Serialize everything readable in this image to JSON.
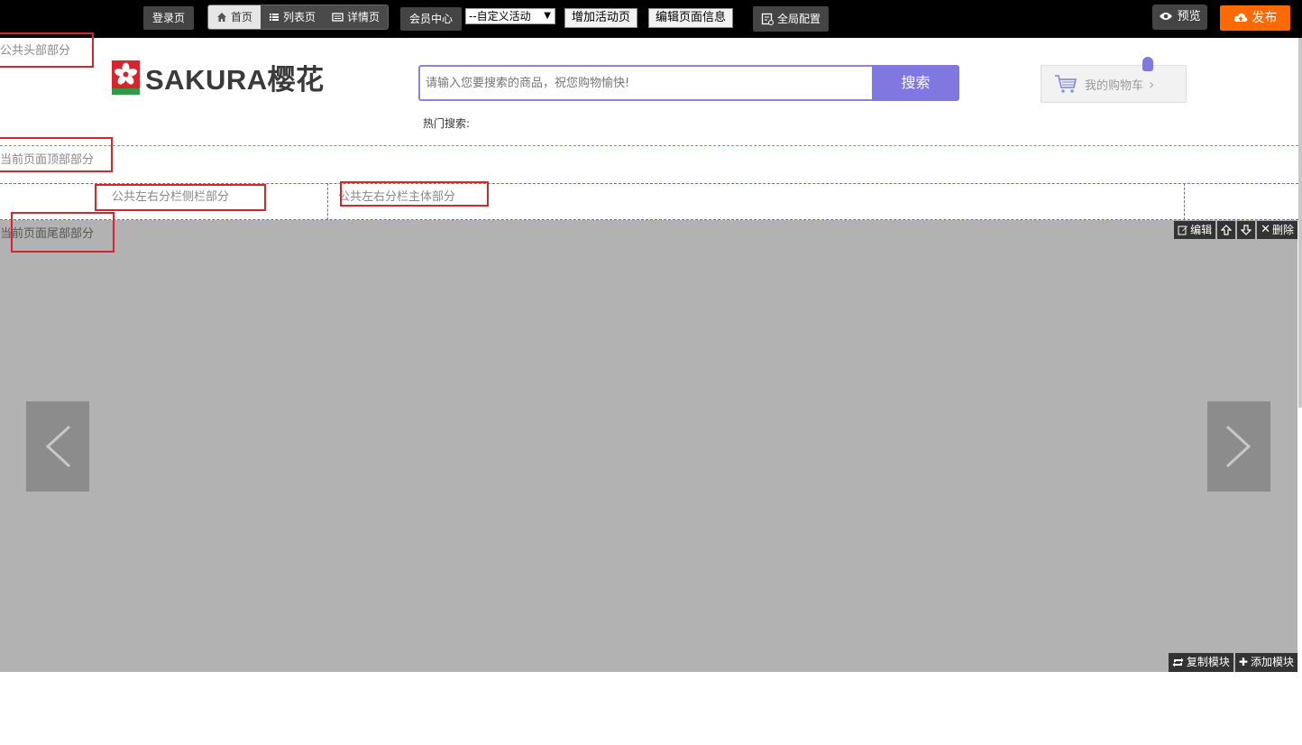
{
  "toolbar": {
    "login_page": "登录页",
    "page_tabs": [
      {
        "label": "首页",
        "icon": "home-icon",
        "active": true
      },
      {
        "label": "列表页",
        "icon": "list-icon",
        "active": false
      },
      {
        "label": "详情页",
        "icon": "detail-icon",
        "active": false
      }
    ],
    "member_center": "会员中心",
    "activity_select": "--自定义活动",
    "add_activity_page": "增加活动页",
    "edit_page_info": "编辑页面信息",
    "global_config": "全局配置",
    "preview": "预览",
    "publish": "发布"
  },
  "sections": {
    "public_header": "公共头部部分",
    "page_top": "当前页面顶部部分",
    "sidebar": "公共左右分栏侧栏部分",
    "main": "公共左右分栏主体部分",
    "page_footer": "当前页面尾部部分"
  },
  "header": {
    "brand_name": "SAKURA樱花",
    "logo_small_text": "SAKURA",
    "search_placeholder": "请输入您要搜索的商品，祝您购物愉快!",
    "search_button": "搜索",
    "hot_search_label": "热门搜索:",
    "cart_label": "我的购物车"
  },
  "module": {
    "edit": "编辑",
    "delete": "删除",
    "copy": "复制模块",
    "add": "添加模块"
  },
  "colors": {
    "accent": "#8077e0",
    "publish": "#ff6a00",
    "brand_red": "#d9232d",
    "banner_gray": "#b2b2b2"
  }
}
